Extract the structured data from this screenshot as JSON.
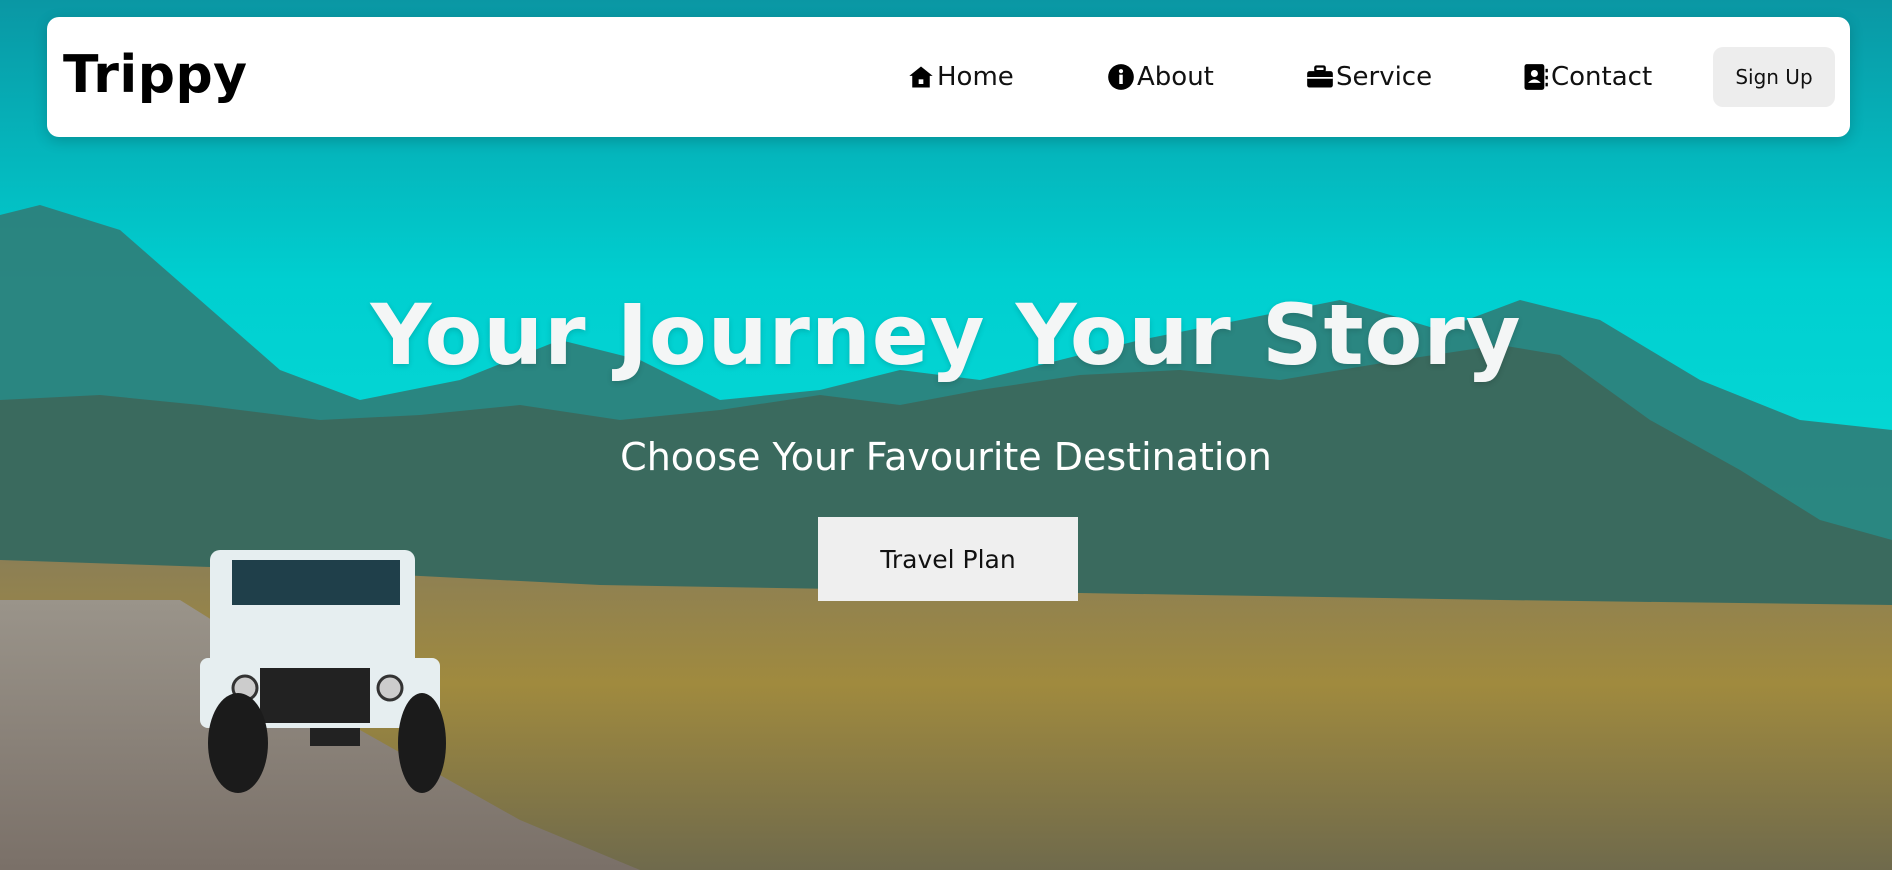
{
  "brand": {
    "name": "Trippy"
  },
  "nav": {
    "items": [
      {
        "label": "Home",
        "icon": "home-icon"
      },
      {
        "label": "About",
        "icon": "info-icon"
      },
      {
        "label": "Service",
        "icon": "briefcase-icon"
      },
      {
        "label": "Contact",
        "icon": "contact-book-icon"
      }
    ],
    "signup_label": "Sign Up"
  },
  "hero": {
    "title": "Your Journey Your Story",
    "subtitle": "Choose Your Favourite Destination",
    "cta_label": "Travel Plan"
  },
  "colors": {
    "sky": "#00d8d6",
    "navbar_bg": "#ffffff",
    "button_bg": "#efefef",
    "title_text": "#f4f6f6"
  }
}
